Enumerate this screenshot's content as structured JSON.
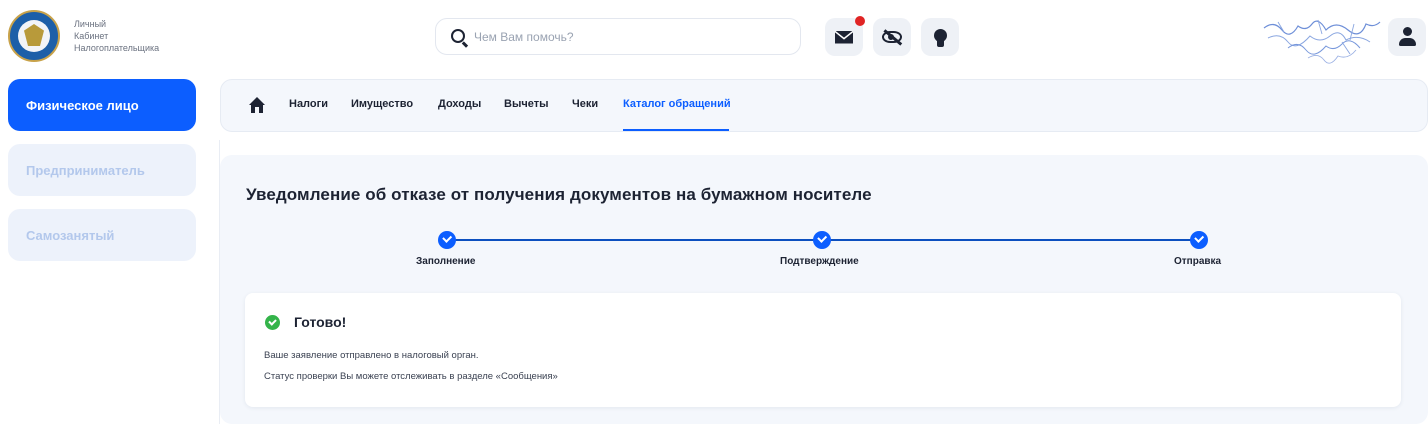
{
  "header": {
    "brand_lines": [
      "Личный",
      "Кабинет",
      "Налогоплательщика"
    ],
    "search_placeholder": "Чем Вам помочь?",
    "accent_color": "#0c5eff",
    "notification_color": "#e02424"
  },
  "sidebar": {
    "items": [
      {
        "label": "Физическое лицо",
        "state": "active"
      },
      {
        "label": "Предприниматель",
        "state": "disabled"
      },
      {
        "label": "Самозанятый",
        "state": "disabled"
      }
    ]
  },
  "tabs": {
    "items": [
      "Налоги",
      "Имущество",
      "Доходы",
      "Вычеты",
      "Чеки",
      "Каталог обращений"
    ],
    "active": "Каталог обращений"
  },
  "main": {
    "title": "Уведомление об отказе от получения документов на бумажном носителе",
    "steps": [
      "Заполнение",
      "Подтверждение",
      "Отправка"
    ],
    "result": {
      "title": "Готово!",
      "lines": [
        "Ваше заявление отправлено в налоговый орган.",
        "Статус проверки Вы можете отслеживать в разделе «Сообщения»"
      ]
    }
  }
}
